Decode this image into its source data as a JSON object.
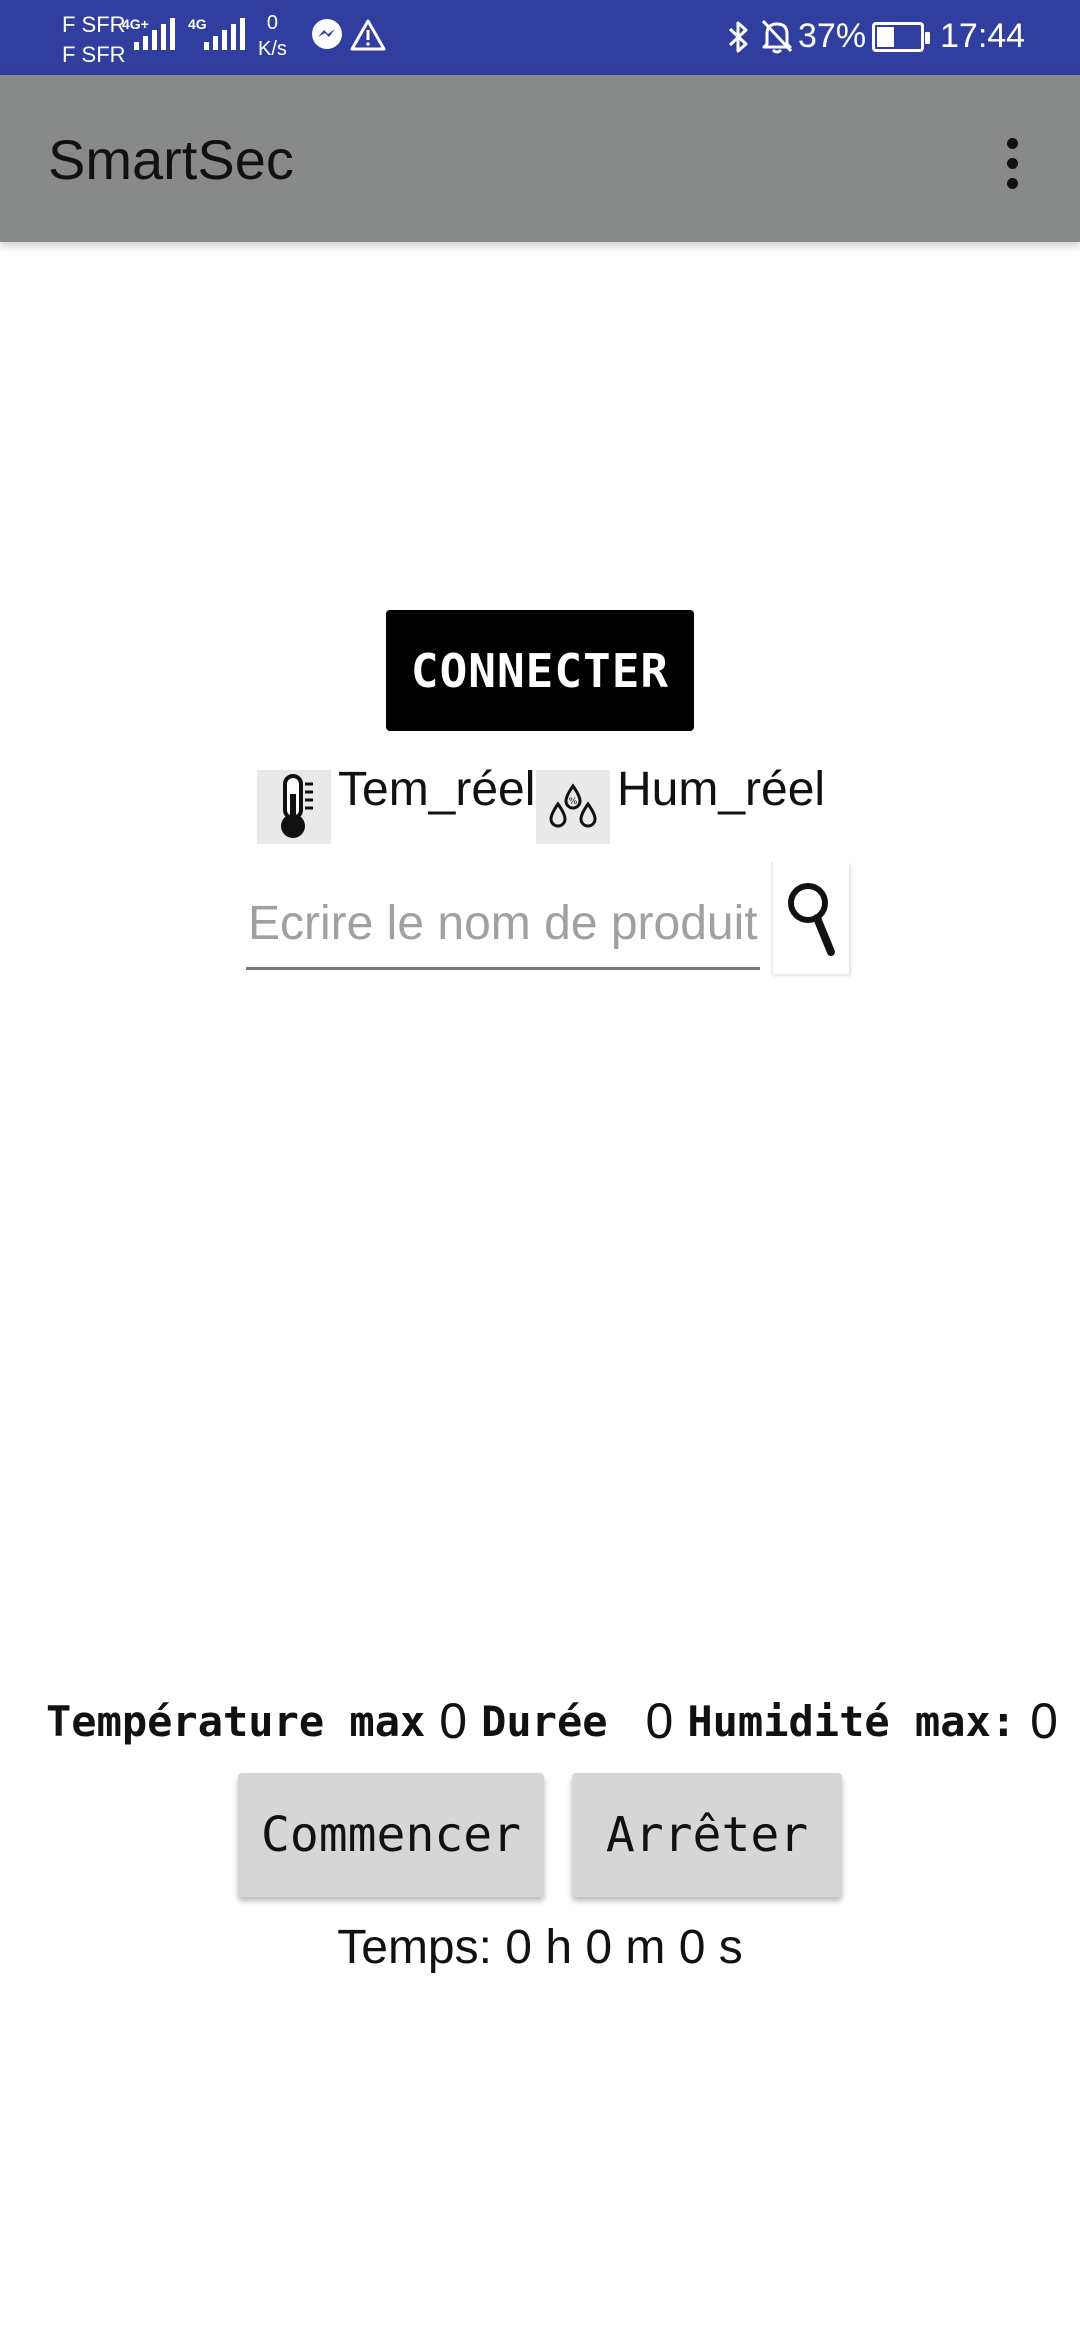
{
  "status_bar": {
    "carrier_1": "F SFR",
    "carrier_2": "F SFR",
    "network_1": "4G+",
    "network_2": "4G",
    "speed_value": "0",
    "speed_unit": "K/s",
    "battery_percent": "37%",
    "battery_level": 0.37,
    "time": "17:44",
    "icons": [
      "messenger-icon",
      "warning-icon",
      "bluetooth-icon",
      "bell-off-icon",
      "battery-icon"
    ],
    "background_color": "#303F9F"
  },
  "app_bar": {
    "title": "SmartSec",
    "menu_icon": "more-vert-icon",
    "background_color": "#888A89"
  },
  "main": {
    "connect_label": "CONNECTER",
    "temperature_label": "Tem_réel",
    "humidity_label": "Hum_réel",
    "temperature_icon": "thermometer-icon",
    "humidity_icon": "water-drops-icon",
    "search": {
      "placeholder": "Ecrire le nom de produit",
      "value": "",
      "icon": "search-icon"
    }
  },
  "stats": {
    "temp_max_label": "Température max",
    "temp_max_value": "0",
    "duration_label": "Durée",
    "duration_value": "0",
    "hum_max_label": "Humidité max:",
    "hum_max_value": "0"
  },
  "actions": {
    "start_label": "Commencer",
    "stop_label": "Arrêter"
  },
  "timer": {
    "text": "Temps: 0 h 0 m 0 s"
  }
}
